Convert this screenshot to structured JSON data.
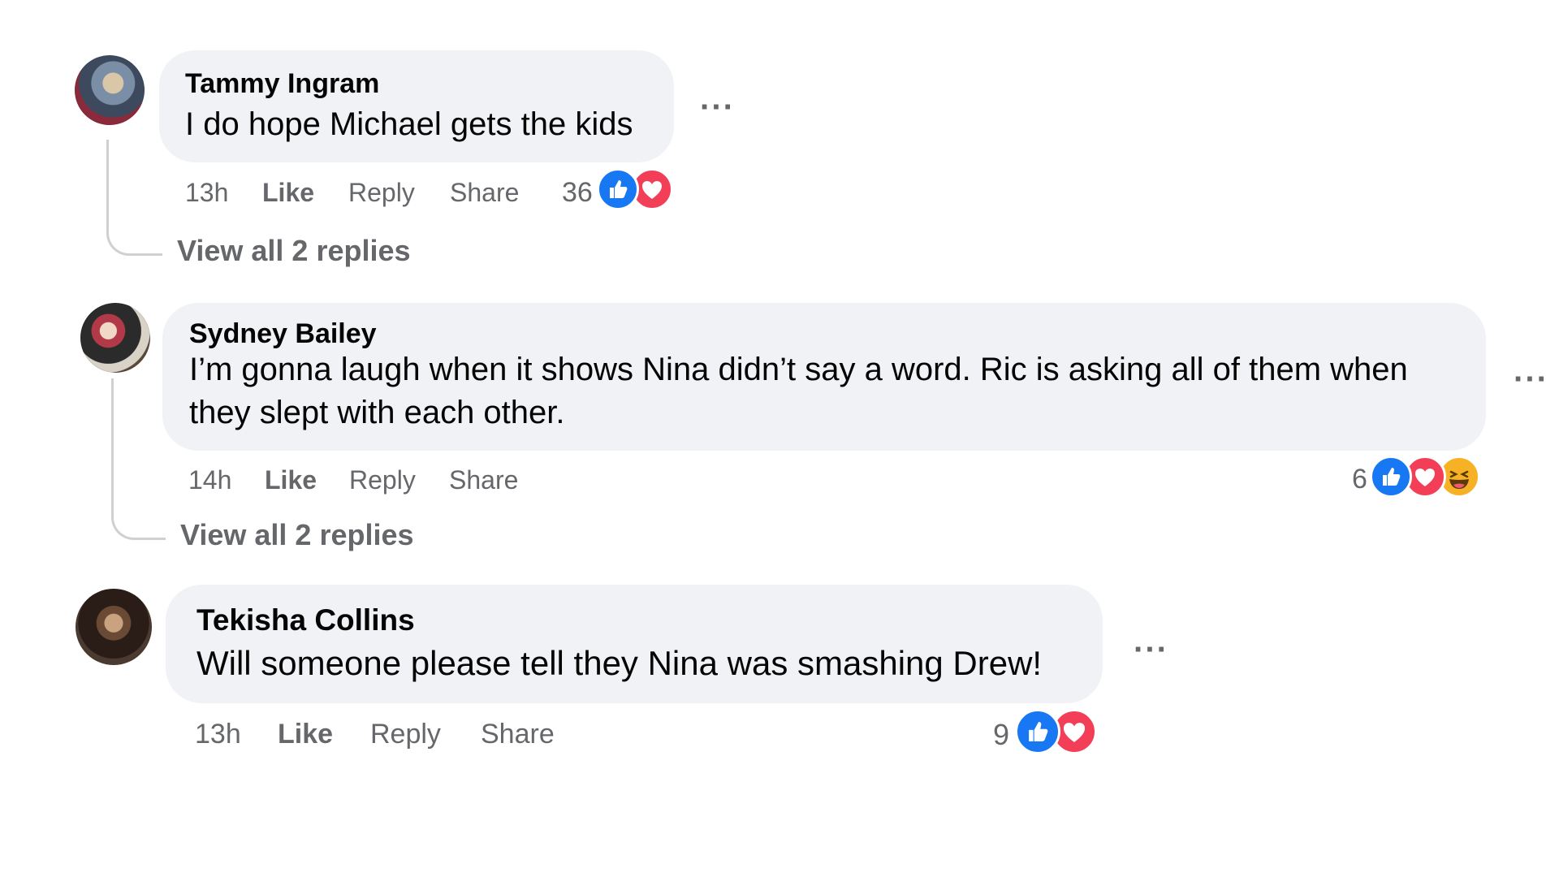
{
  "comments": [
    {
      "author": "Tammy Ingram",
      "text": "I do hope Michael gets the kids",
      "more_label": "···",
      "time": "13h",
      "like_label": "Like",
      "reply_label": "Reply",
      "share_label": "Share",
      "reaction_count": "36",
      "reactions": [
        "like-icon",
        "love-icon"
      ],
      "view_replies": "View all 2 replies"
    },
    {
      "author": "Sydney Bailey",
      "text": "I’m gonna laugh when it shows Nina didn’t say a word. Ric is asking all of them when they slept with each other.",
      "more_label": "···",
      "time": "14h",
      "like_label": "Like",
      "reply_label": "Reply",
      "share_label": "Share",
      "reaction_count": "6",
      "reactions": [
        "like-icon",
        "love-icon",
        "haha-icon"
      ],
      "view_replies": "View all 2 replies"
    },
    {
      "author": "Tekisha Collins",
      "text": "Will someone please tell they Nina was smashing Drew!",
      "more_label": "···",
      "time": "13h",
      "like_label": "Like",
      "reply_label": "Reply",
      "share_label": "Share",
      "reaction_count": "9",
      "reactions": [
        "like-icon",
        "love-icon"
      ]
    }
  ],
  "colors": {
    "bubble": "#f0f2f5",
    "secondary_text": "#65676b",
    "like_blue": "#1877f2",
    "love_red": "#f33e58",
    "haha_yellow": "#f7b125"
  }
}
